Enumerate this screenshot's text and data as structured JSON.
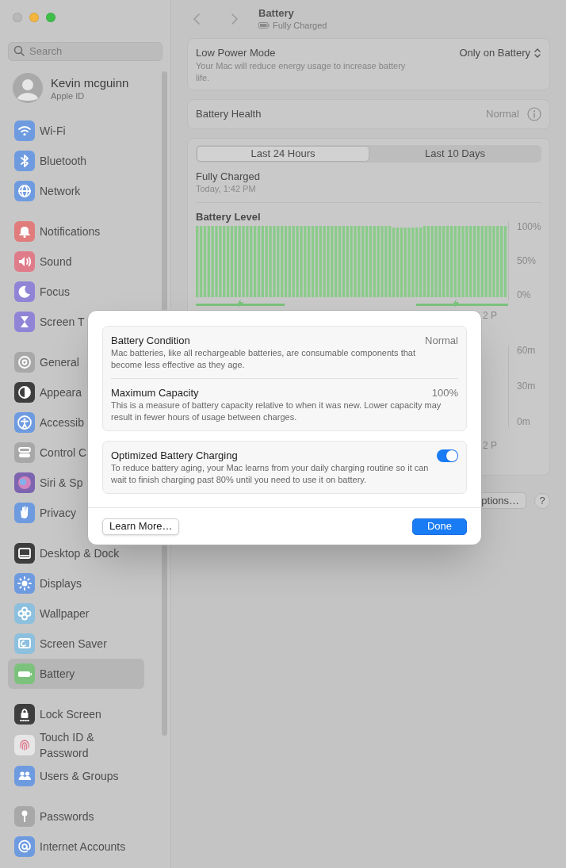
{
  "sidebar": {
    "search": {
      "placeholder": "Search"
    },
    "account": {
      "name": "Kevin mcguinn",
      "subtitle": "Apple ID"
    },
    "groups": [
      [
        {
          "label": "Wi-Fi",
          "kind": "wifi",
          "color": "#6e9be0",
          "selected": false
        },
        {
          "label": "Bluetooth",
          "kind": "bluetooth",
          "color": "#6e9be0",
          "selected": false
        },
        {
          "label": "Network",
          "kind": "globe",
          "color": "#6e9be0",
          "selected": false
        }
      ],
      [
        {
          "label": "Notifications",
          "kind": "bell",
          "color": "#e07c7c",
          "selected": false
        },
        {
          "label": "Sound",
          "kind": "speaker",
          "color": "#e07c8a",
          "selected": false
        },
        {
          "label": "Focus",
          "kind": "moon",
          "color": "#8f84d6",
          "selected": false
        },
        {
          "label": "Screen T",
          "kind": "hourglass",
          "color": "#8f84d6",
          "selected": false
        }
      ],
      [
        {
          "label": "General",
          "kind": "gear",
          "color": "#a8a8a8",
          "selected": false
        },
        {
          "label": "Appeara",
          "kind": "contrast",
          "color": "#3e3e3e",
          "selected": false
        },
        {
          "label": "Accessib",
          "kind": "person",
          "color": "#6e9be0",
          "selected": false
        },
        {
          "label": "Control C",
          "kind": "switches",
          "color": "#a8a8a8",
          "selected": false
        },
        {
          "label": "Siri & Sp",
          "kind": "orb",
          "color": "#7d64b0",
          "selected": false
        },
        {
          "label": "Privacy",
          "kind": "hand",
          "color": "#6e9be0",
          "selected": false
        }
      ],
      [
        {
          "label": "Desktop & Dock",
          "kind": "dock",
          "color": "#3e3e3e",
          "selected": false
        },
        {
          "label": "Displays",
          "kind": "sun",
          "color": "#6e9be0",
          "selected": false
        },
        {
          "label": "Wallpaper",
          "kind": "flower",
          "color": "#8cc0de",
          "selected": false
        },
        {
          "label": "Screen Saver",
          "kind": "screen",
          "color": "#8cc0de",
          "selected": false
        },
        {
          "label": "Battery",
          "kind": "battery",
          "color": "#7cc27c",
          "selected": true
        }
      ],
      [
        {
          "label": "Lock Screen",
          "kind": "lock",
          "color": "#3e3e3e",
          "selected": false
        },
        {
          "label": "Touch ID & Password",
          "kind": "fingerprint",
          "color": "#e6e6e6",
          "selected": false
        },
        {
          "label": "Users & Groups",
          "kind": "people",
          "color": "#6e9be0",
          "selected": false
        }
      ],
      [
        {
          "label": "Passwords",
          "kind": "key",
          "color": "#a8a8a8",
          "selected": false
        },
        {
          "label": "Internet Accounts",
          "kind": "at",
          "color": "#6e9be0",
          "selected": false
        }
      ]
    ]
  },
  "header": {
    "title": "Battery",
    "subtitle": "Fully Charged"
  },
  "low_power": {
    "label": "Low Power Mode",
    "description": "Your Mac will reduce energy usage to increase battery life.",
    "value": "Only on Battery"
  },
  "battery_health": {
    "label": "Battery Health",
    "value": "Normal"
  },
  "usage": {
    "tabs": [
      {
        "label": "Last 24 Hours",
        "selected": true
      },
      {
        "label": "Last 10 Days",
        "selected": false
      }
    ],
    "status": "Fully Charged",
    "time": "Today, 1:42 PM",
    "chart_title": "Battery Level",
    "level_axis": [
      "100%",
      "50%",
      "0%"
    ],
    "time_label": "2 P",
    "activity_axis": [
      "60m",
      "30m",
      "0m"
    ],
    "activity_time_label": "2 P"
  },
  "options_button": "ptions…",
  "help_button": "?",
  "dialog": {
    "rows": [
      {
        "title": "Battery Condition",
        "value": "Normal",
        "description": "Mac batteries, like all rechargeable batteries, are consumable components that become less effective as they age."
      },
      {
        "title": "Maximum Capacity",
        "value": "100%",
        "description": "This is a measure of battery capacity relative to when it was new. Lower capacity may result in fewer hours of usage between charges."
      }
    ],
    "optimized": {
      "title": "Optimized Battery Charging",
      "description": "To reduce battery aging, your Mac learns from your daily charging routine so it can wait to finish charging past 80% until you need to use it on battery.",
      "on": true
    },
    "buttons": [
      {
        "label": "Learn More…",
        "kind": "secondary"
      },
      {
        "label": "Done",
        "kind": "primary"
      }
    ]
  }
}
